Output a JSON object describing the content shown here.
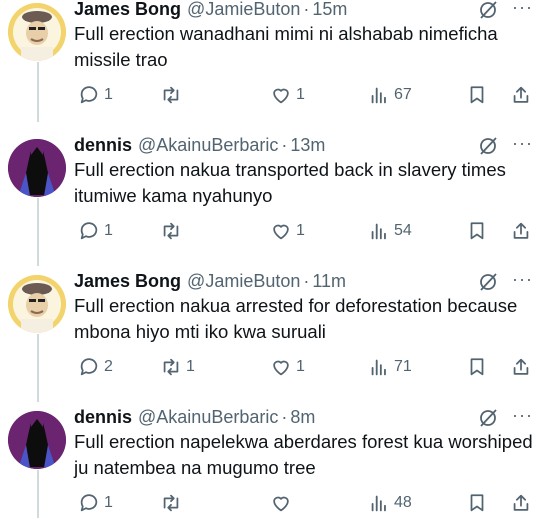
{
  "tweets": [
    {
      "name": "James Bong",
      "handle": "@JamieButon",
      "sep": "·",
      "time": "15m",
      "text": "Full erection wanadhani mimi ni alshabab nimeficha missile trao",
      "replies": "1",
      "retweets": "",
      "likes": "1",
      "views": "67",
      "avatar": "beige-hat-avatar"
    },
    {
      "name": "dennis",
      "handle": "@AkainuBerbaric",
      "sep": "·",
      "time": "13m",
      "text": "Full erection nakua transported back in slavery times itumiwe kama nyahunyo",
      "replies": "1",
      "retweets": "",
      "likes": "1",
      "views": "54",
      "avatar": "purple-batman-avatar"
    },
    {
      "name": "James Bong",
      "handle": "@JamieButon",
      "sep": "·",
      "time": "11m",
      "text": "Full erection nakua arrested for deforestation because mbona hiyo mti iko kwa suruali",
      "replies": "2",
      "retweets": "1",
      "likes": "1",
      "views": "71",
      "avatar": "beige-hat-avatar"
    },
    {
      "name": "dennis",
      "handle": "@AkainuBerbaric",
      "sep": "·",
      "time": "8m",
      "text": "Full erection napelekwa aberdares forest kua worshiped ju natembea na mugumo tree",
      "replies": "1",
      "retweets": "",
      "likes": "",
      "views": "48",
      "avatar": "purple-batman-avatar"
    }
  ],
  "more_glyph": "···",
  "colors": {
    "text": "#0f1419",
    "muted": "#536471",
    "thread_line": "#cfd9de"
  }
}
